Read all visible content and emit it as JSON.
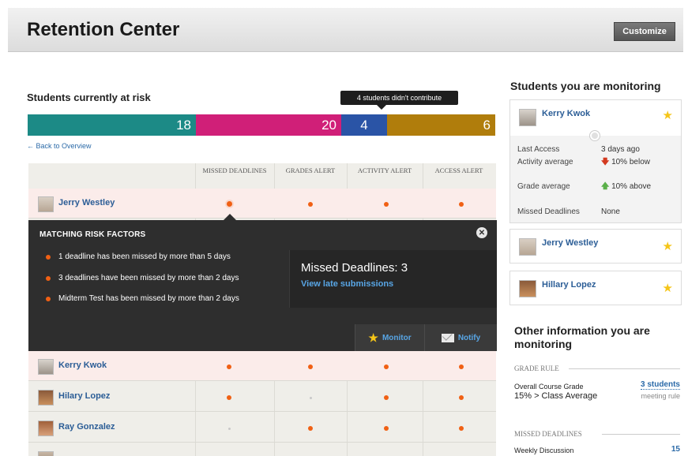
{
  "header": {
    "title": "Retention Center",
    "customize_label": "Customize"
  },
  "risk": {
    "title": "Students currently at risk",
    "tooltip": "4 students didn't contribute",
    "segments": [
      {
        "value": "18",
        "color": "#1c8a86"
      },
      {
        "value": "20",
        "color": "#d01f78"
      },
      {
        "value": "4",
        "color": "#2a54a6"
      },
      {
        "value": "6",
        "color": "#b07d0c"
      }
    ],
    "back_link": "← Back to Overview"
  },
  "table": {
    "columns": [
      "MISSED DEADLINES",
      "GRADES ALERT",
      "ACTIVITY ALERT",
      "ACCESS ALERT"
    ],
    "rows": [
      {
        "name": "Jerry Westley"
      },
      {
        "name": "Kerry Kwok"
      },
      {
        "name": "Hilary Lopez"
      },
      {
        "name": "Ray Gonzalez"
      }
    ]
  },
  "popover": {
    "heading": "MATCHING RISK FACTORS",
    "factors": [
      "1 deadline has been missed by more than 5 days",
      "3 deadlines have been missed by more than 2 days",
      "Midterm Test has been missed by more than 2 days"
    ],
    "missed_title": "Missed Deadlines: 3",
    "missed_link": "View late submissions",
    "monitor_label": "Monitor",
    "notify_label": "Notify"
  },
  "monitoring": {
    "title": "Students you are monitoring",
    "expanded": {
      "name": "Kerry Kwok",
      "fields": [
        {
          "label": "Last Access",
          "value": "3 days ago"
        },
        {
          "label": "Activity average",
          "value": "10% below",
          "arrow": "down"
        },
        {
          "label": "Grade average",
          "value": "10% above",
          "arrow": "up"
        },
        {
          "label": "Missed Deadlines",
          "value": "None"
        }
      ]
    },
    "others": [
      {
        "name": "Jerry Westley"
      },
      {
        "name": "Hillary Lopez"
      }
    ]
  },
  "other_info": {
    "title": "Other information you are monitoring",
    "grade_rule": {
      "heading": "GRADE RULE",
      "label_line1": "Overall Course Grade",
      "label_line2": "15% > Class Average",
      "link": "3 students",
      "note": "meeting rule"
    },
    "missed_deadlines": {
      "heading": "MISSED DEADLINES",
      "label": "Weekly Discussion",
      "value": "15"
    }
  }
}
